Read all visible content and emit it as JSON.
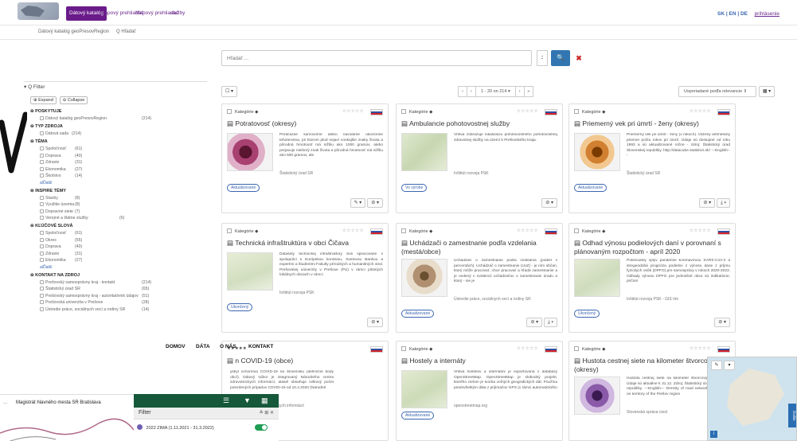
{
  "nav": {
    "items": [
      "Dátový katalóg",
      "Mapový prehliadač",
      "Mapový prehliadač",
      "služby"
    ],
    "lang": "SK | EN | DE",
    "login": "prihlásenie"
  },
  "subnav": {
    "crumb1": "Dátový katalóg geoPresovRegion",
    "crumb2": "Q Hľadať"
  },
  "search": {
    "placeholder": "Hľadať ...",
    "mid": ":",
    "btn": "🔍",
    "clear": "✖"
  },
  "filter": {
    "title": "▾ Q Filter",
    "expand": "⊕ Expand",
    "collapse": "⊖ Collapse",
    "groups": [
      {
        "title": "⊖ POSKYTUJE",
        "opts": [
          [
            "Dátový katalóg geoPresovRegion",
            "(214)"
          ]
        ]
      },
      {
        "title": "⊖ TYP ZDROJA",
        "opts": [
          [
            "Dátová sada",
            "(214)"
          ]
        ]
      },
      {
        "title": "⊖ TÉMA",
        "opts": [
          [
            "Spoločnosť",
            "(61)"
          ],
          [
            "Doprava",
            "(40)"
          ],
          [
            "Zdravie",
            "(31)"
          ],
          [
            "Ekonomika",
            "(27)"
          ],
          [
            "Školstvo",
            "(14)"
          ]
        ],
        "more": "a/Ďalší"
      },
      {
        "title": "⊖ INSPIRE TÉMY",
        "opts": [
          [
            "Stavby",
            "(8)"
          ],
          [
            "Využitie územia",
            "(8)"
          ],
          [
            "Dopravné siete",
            "(7)"
          ],
          [
            "Verejné a štátne služby",
            "(6)"
          ]
        ]
      },
      {
        "title": "⊖ KĽÚČOVÉ SLOVÁ",
        "opts": [
          [
            "Spoločnosť",
            "(61)"
          ],
          [
            "Okres",
            "(55)"
          ],
          [
            "Doprava",
            "(40)"
          ],
          [
            "Zdravie",
            "(31)"
          ],
          [
            "Ekonomika",
            "(27)"
          ]
        ],
        "more": "a/Ďalší"
      },
      {
        "title": "⊖ KONTAKT NA ZDROJ",
        "opts": [
          [
            "Prešovský samosprávny kraj - kontakt",
            "(214)"
          ],
          [
            "Štatistický úrad SR",
            "(65)"
          ],
          [
            "Prešovský samosprávny kraj - autoritatívnik údajov",
            "(51)"
          ],
          [
            "Prešovská univerzita v Prešove",
            "(28)"
          ],
          [
            "Ústredie práce, sociálnych vecí a rodiny SR",
            "(14)"
          ]
        ]
      }
    ]
  },
  "toolbar": {
    "select": "☐ ▾",
    "pager": [
      "‹",
      "‹",
      "1 - 20 on 214 ▾",
      "›",
      "»"
    ],
    "sort": "Usporiadané podľa relevancie ⇕",
    "view": "▦ ▾"
  },
  "cards": [
    {
      "cat": "Kategórie ◆",
      "stars": "☆☆☆☆☆",
      "title": "Potratovosť (okresy)",
      "desc": "Predčasné samovoľné alebo navodené ukončenie tehotenstva, pri ktorom plod nejaví vonkajšie znaky života a pôrodná hmotnosť má nižšiu ako 1000 gramov, alebo prejavuje niektorý znak života a pôrodná hmotnosť má nižšiu ako 500 gramov, ale",
      "source": "Štatistický úrad SR",
      "badge": "Aktualizované",
      "actions": [
        "✎ ▾",
        "⊘ ▾"
      ]
    },
    {
      "cat": "Kategórie ◆",
      "stars": "☆☆☆☆☆",
      "title": "Ambulancie pohotovostnej služby",
      "desc": "Vrstva zobrazuje lokalizáciu pohotovostného pohotovostnej zdravotnej služby na území k Prešovského kraja.",
      "source": "Inštitút rozvoja PSK",
      "badge": "Vo výrobe",
      "actions": [
        "⊘ ▾"
      ]
    },
    {
      "cat": "Kategórie ◆",
      "stars": "☆☆☆☆☆",
      "title": "Priemerný vek pri úmrtí - ženy (okresy)",
      "desc": "Priemerný vek pri úmrtí - ženy (v rokoch). Vážený aritmetický priemer počtu rokov pri úmrtí. Údaje sú dostupné od roku 1993 a sú aktualizované ročne - zdroj: Štatistický úrad Slovenskej republiky. http://datacube.statistics.sk/ ---English---",
      "source": "Štatistický úrad SR",
      "badge": "Aktualizované",
      "actions": [
        "⊘ ▾",
        "⤓ ▾"
      ]
    },
    {
      "cat": "Kategórie ◆",
      "stars": "☆☆☆☆☆",
      "title": "Technická infraštruktúra v obci Čičava",
      "desc": "Datasety technickej infraštruktúry boli spracované v spolupráci s Európskou komisiou, Svetovou Bankou a expertmi a študentmi Fakulty prírodných a humanitných vied, Prešovskej univerzity v Prešove (PU) v rámci pilotných lokálnych obciach v rámci",
      "source": "Inštitút rozvoja PSK",
      "badge": "Ukončený",
      "actions": [
        "⊘ ▾"
      ]
    },
    {
      "cat": "Kategórie ◆",
      "stars": "☆☆☆☆☆",
      "title": "Uchádzači o zamestnanie podľa vzdelania (mestá/obce)",
      "desc": "Uchádzači o zamestnanie podľa vzdelania (podiel v percentách). Uchádzač o zamestnanie (UoZ) - je ním občan, ktorý môže pracovať, chce pracovať a hľadá zamestnanie a je vedený v evidencii uchádzačov o zamestnanie úradu a ktorý - nie je",
      "source": "Ústredie práce, sociálnych vecí a rodiny SR",
      "badge": "Aktualizované",
      "actions": [
        "⊘ ▾",
        "⤓ ▾"
      ]
    },
    {
      "cat": "Kategórie ◆",
      "stars": "☆☆☆☆☆",
      "title": "Odhad výnosu podielových daní v porovnaní s plánovaným rozpočtom - apríl 2020",
      "desc": "Potenciálny vplyv pandémie koronavírusu SARS-CoV-2 a streднodobá prognóza podielov z výnosu dane z príjmu fyzických osôb (DPFO) pre samosprávy v rokoch 2020-2023. Odhady výnosu DPFO pre jednotlivé obce sú indikatívne, pričom",
      "source": "Inštitút rozvoja PSK - GIS tím",
      "badge": "Ukončený",
      "actions": [
        "⊘ ▾"
      ]
    },
    {
      "cat": "★★★★★",
      "stars": "",
      "title": "n COVID-19 (obce)",
      "desc": "ýskyt ochorenia COVID-19 na Slovensku (definičné body obcí). Dátový súbor je integrovaný Národného centra zdravotníckych informácií, atasel obsahuje celkový počet potvrdených prípadov COVID-19 od 10.4.2020 (Národné",
      "source": "árodné centrum zdravotníckych informácií",
      "badge": "",
      "actions": []
    },
    {
      "cat": "Kategórie ◆",
      "stars": "☆☆☆☆☆",
      "title": "Hostely a internáty",
      "desc": "Vrstva hostelov a internátov je exportovaná z databázy OpenStreetMap. OpenStreetMap je slobodný projekt, ktorého cieľom je tvorba voľných geografických dát. Používa predovšetkým dáta z prijímačov GPS (v rámci automatického",
      "source": "openstreetmap.org",
      "badge": "Aktualizované",
      "actions": []
    },
    {
      "cat": "Kategórie ◆",
      "stars": "☆☆☆☆☆",
      "title": "Hustota cestnej siete na kilometer štvorcov (okresy)",
      "desc": "Hustota cestnej siete na kilometer štvorcový kilometrech. Údaje sú aktuálne k 31.12. Zdroj: Štatistický úrad Slovenskej republiky. ---English--- Density of road network in kilometer on territory of the Prešov region",
      "source": "Slovenská správa ciest",
      "badge": "",
      "actions": []
    }
  ],
  "footer": {
    "home": "DOMOV",
    "data": "DÁTA",
    "about": "O NÁS",
    "contact": "KONTAKT"
  },
  "bottom_map": {
    "dots": "...",
    "title": "Magistrát hlavného mesta SR Bratislava",
    "filter_label": "Filter",
    "filter_icons": "≚ ⊞ ✕",
    "season": "2022 ZIMA (1.11.2021 - 31.3.2022)"
  },
  "mini_map": {
    "side": "Ďalšie",
    "info": "i",
    "pen": "✎",
    "layers": "▾"
  }
}
